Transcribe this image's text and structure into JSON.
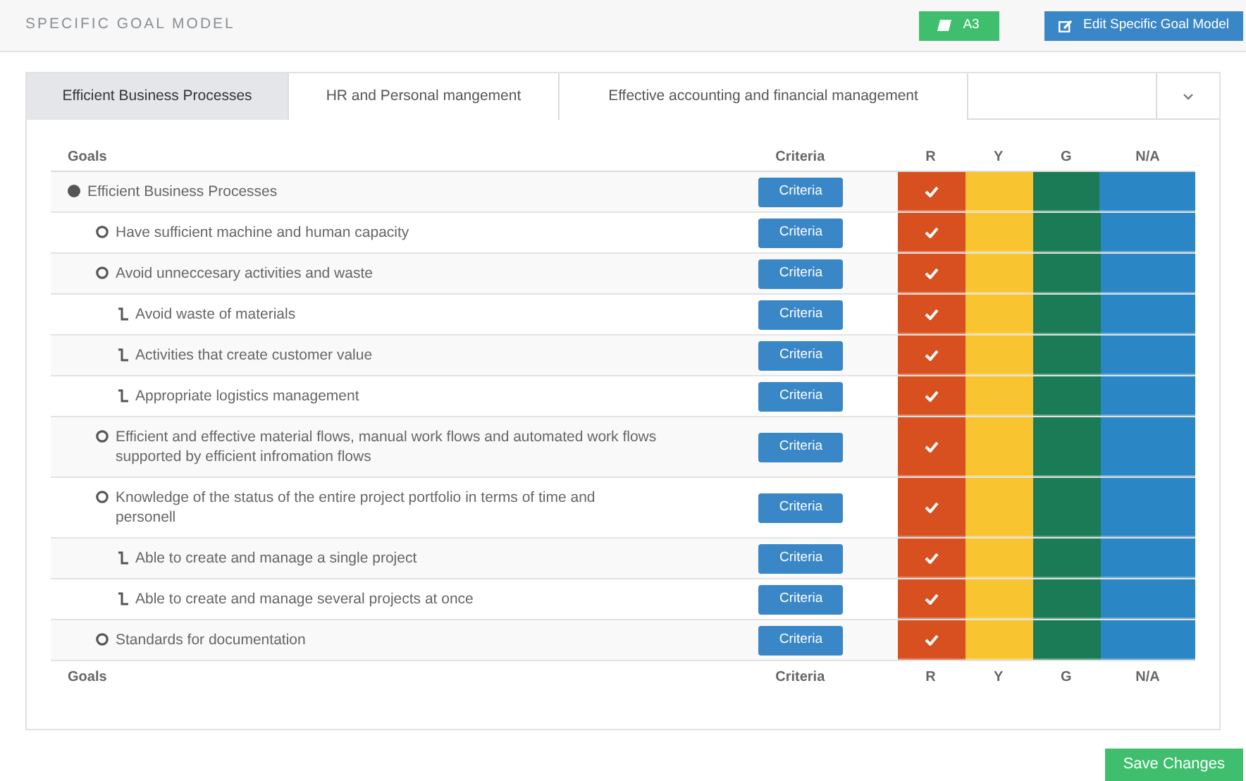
{
  "header": {
    "title": "SPECIFIC GOAL MODEL",
    "buttons": [
      {
        "kind": "a3",
        "label": "A3"
      },
      {
        "kind": "edit",
        "label": "Edit Specific Goal Model"
      }
    ]
  },
  "tabs": [
    {
      "label": "Efficient Business Processes",
      "selected": true
    },
    {
      "label": "HR and Personal mangement",
      "selected": false
    },
    {
      "label": "Effective accounting and financial management",
      "selected": false
    }
  ],
  "table": {
    "columns": [
      {
        "label": "Goals"
      },
      {
        "label": "Criteria"
      }
    ],
    "rating_columns": [
      {
        "label": "R",
        "color": "#d8501f"
      },
      {
        "label": "Y",
        "color": "#f8c42f"
      },
      {
        "label": "G",
        "color": "#1b7b56"
      },
      {
        "label": "N/A",
        "color": "#2b86c5"
      }
    ],
    "goals": [
      {
        "label": "Efficient Business Processes",
        "button": "Criteria",
        "checks": [
          true,
          false,
          false,
          false
        ],
        "children": [
          {
            "label": "Have sufficient machine and human capacity",
            "button": "Criteria",
            "checks": [
              true,
              false,
              false,
              false
            ]
          },
          {
            "label": "Avoid unneccesary activities and waste",
            "button": "Criteria",
            "checks": [
              true,
              false,
              false,
              false
            ],
            "children": [
              {
                "label": "Avoid waste of materials",
                "button": "Criteria",
                "checks": [
                  true,
                  false,
                  false,
                  false
                ]
              },
              {
                "label": "Activities that create customer value",
                "button": "Criteria",
                "checks": [
                  true,
                  false,
                  false,
                  false
                ]
              },
              {
                "label": "Appropriate logistics management",
                "button": "Criteria",
                "checks": [
                  true,
                  false,
                  false,
                  false
                ]
              }
            ]
          },
          {
            "label": "Efficient and effective material flows, manual work flows and automated work flows supported by efficient infromation flows",
            "button": "Criteria",
            "checks": [
              true,
              false,
              false,
              false
            ]
          },
          {
            "label": "Knowledge of the status of the entire project portfolio in terms of time and personell",
            "button": "Criteria",
            "checks": [
              true,
              false,
              false,
              false
            ],
            "children": [
              {
                "label": "Able to create and manage a single project",
                "button": "Criteria",
                "checks": [
                  true,
                  false,
                  false,
                  false
                ]
              },
              {
                "label": "Able to create and manage several projects at once",
                "button": "Criteria",
                "checks": [
                  true,
                  false,
                  false,
                  false
                ]
              }
            ]
          },
          {
            "label": "Standards for documentation",
            "button": "Criteria",
            "checks": [
              true,
              false,
              false,
              false
            ]
          }
        ]
      }
    ],
    "footer_columns": [
      {
        "label": "Goals"
      },
      {
        "label": "Criteria"
      },
      {
        "label": "R"
      },
      {
        "label": "Y"
      },
      {
        "label": "G"
      },
      {
        "label": "N/A"
      }
    ]
  },
  "save_button": "Save Changes"
}
